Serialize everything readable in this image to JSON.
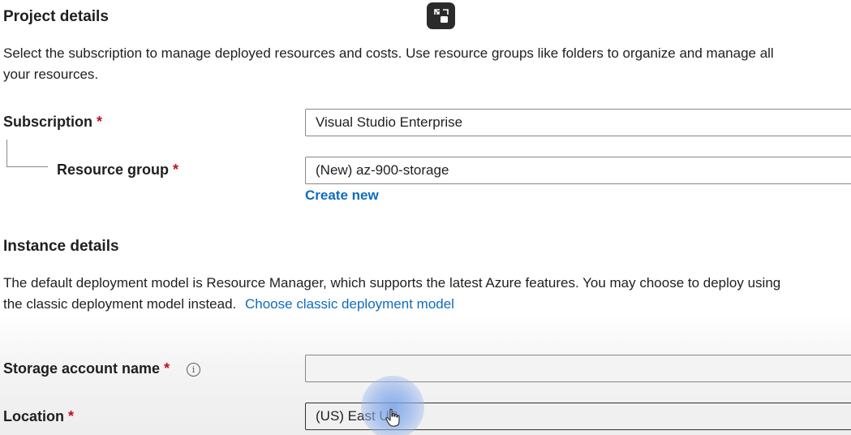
{
  "project": {
    "heading": "Project details",
    "description_line1": "Select the subscription to manage deployed resources and costs. Use resource groups like folders to organize and manage all",
    "description_line2": "your resources."
  },
  "subscription": {
    "label": "Subscription",
    "required_mark": "*",
    "value": "Visual Studio Enterprise"
  },
  "resource_group": {
    "label": "Resource group",
    "required_mark": "*",
    "value": "(New) az-900-storage",
    "create_new_link": "Create new"
  },
  "instance": {
    "heading": "Instance details",
    "description_line1": "The default deployment model is Resource Manager, which supports the latest Azure features. You may choose to deploy using",
    "description_line2_text": "the classic deployment model instead.",
    "classic_link": "Choose classic deployment model"
  },
  "storage_account": {
    "label": "Storage account name",
    "required_mark": "*",
    "info_glyph": "i",
    "value": ""
  },
  "location": {
    "label": "Location",
    "required_mark": "*",
    "value": "(US) East US"
  },
  "colors": {
    "link": "#0f6cbd",
    "required": "#c50f1f",
    "overlay_button": "#2b2b2b",
    "cursor_highlight": "#8fb0ea"
  },
  "icons": {
    "exit_fullscreen": "exit-fullscreen-icon",
    "info": "info-icon",
    "cursor": "hand-cursor-icon"
  }
}
